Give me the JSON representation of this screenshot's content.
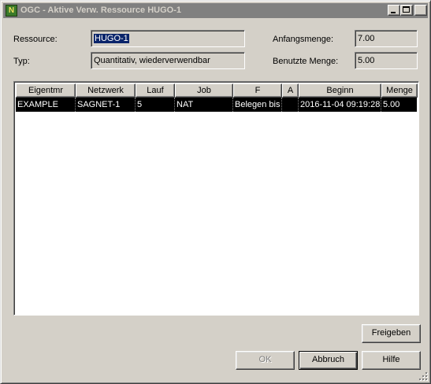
{
  "window": {
    "title": "OGC - Aktive Verw. Ressource HUGO-1",
    "icon_letter": "N",
    "controls": {
      "minimize": "minimize",
      "maximize": "maximize",
      "close": "×"
    }
  },
  "form": {
    "ressource_label": "Ressource:",
    "ressource_value": "HUGO-1",
    "typ_label": "Typ:",
    "typ_value": "Quantitativ, wiederverwendbar",
    "anfangsmenge_label": "Anfangsmenge:",
    "anfangsmenge_value": "7.00",
    "benutzte_menge_label": "Benutzte Menge:",
    "benutzte_menge_value": "5.00"
  },
  "table": {
    "columns": [
      "Eigentmr",
      "Netzwerk",
      "Lauf",
      "Job",
      "F",
      "A",
      "Beginn",
      "Menge"
    ],
    "rows": [
      {
        "cells": [
          "EXAMPLE",
          "SAGNET-1",
          "5",
          "NAT",
          "Belegen bis",
          "",
          "2016-11-04 09:19:28",
          "5.00"
        ],
        "selected": true
      }
    ]
  },
  "buttons": {
    "freigeben": "Freigeben",
    "ok": "OK",
    "abbruch": "Abbruch",
    "hilfe": "Hilfe"
  }
}
